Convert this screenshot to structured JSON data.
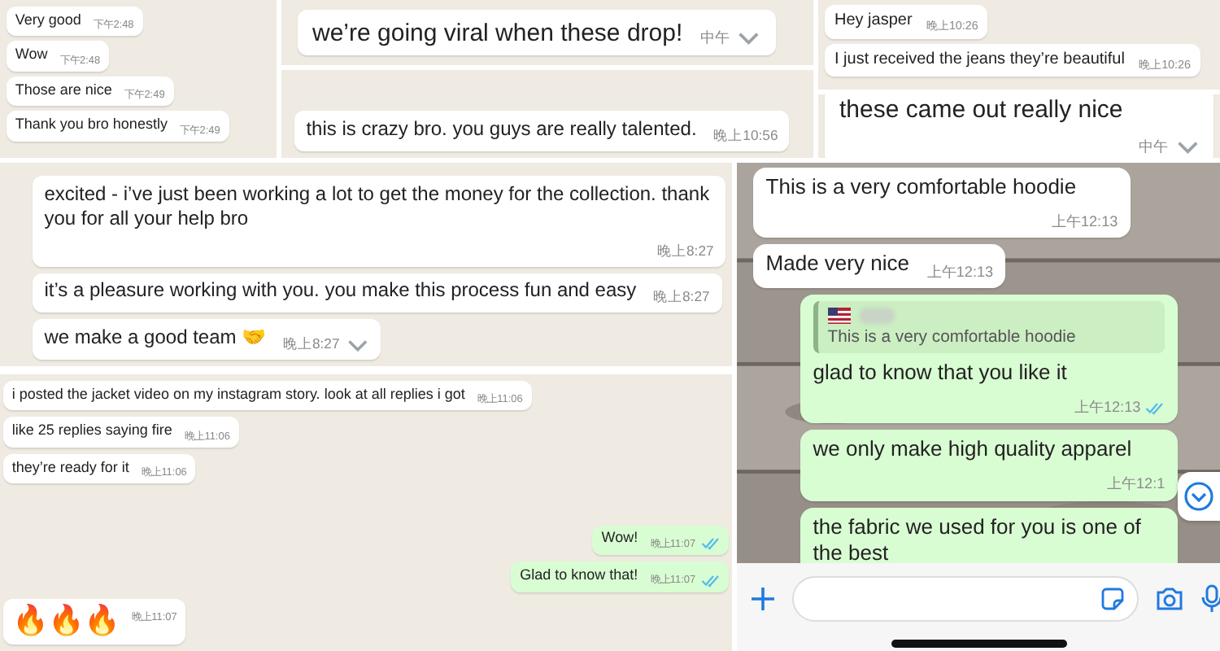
{
  "chats": [
    {
      "kind": "desktop",
      "messages": [
        {
          "text": "Very good",
          "time": "下午2:48",
          "outgoing": false
        },
        {
          "text": "Wow",
          "time": "下午2:48",
          "outgoing": false
        },
        {
          "text": "Those are nice",
          "time": "下午2:49",
          "outgoing": false
        },
        {
          "text": "Thank you bro honestly",
          "time": "下午2:49",
          "outgoing": false
        }
      ]
    },
    {
      "kind": "desktop",
      "messages": [
        {
          "text": "we’re going viral when these drop!",
          "time": "中午",
          "outgoing": false,
          "hovered": true
        }
      ]
    },
    {
      "kind": "desktop",
      "messages": [
        {
          "text": "this is crazy bro. you guys are really talented.",
          "time": "晚上10:56",
          "outgoing": false
        }
      ]
    },
    {
      "kind": "desktop",
      "messages": [
        {
          "text": "Hey jasper",
          "time": "晚上10:26",
          "outgoing": false
        },
        {
          "text": "I just received the jeans they’re beautiful",
          "time": "晚上10:26",
          "outgoing": false
        }
      ]
    },
    {
      "kind": "desktop",
      "messages": [
        {
          "text": "these came out really nice",
          "time": "中午",
          "outgoing": false,
          "hovered": true
        }
      ]
    },
    {
      "kind": "desktop",
      "messages": [
        {
          "text": "excited - i’ve just been working a lot to get the money for the collection. thank you for all your help bro",
          "time": "晚上8:27",
          "outgoing": false
        },
        {
          "text": "it’s a pleasure working with you. you make this process fun and easy",
          "time": "晚上8:27",
          "outgoing": false
        },
        {
          "text": "we make a good team 🤝",
          "time": "晚上8:27",
          "outgoing": false,
          "hovered": true
        }
      ]
    },
    {
      "kind": "desktop",
      "messages": [
        {
          "text": "i posted the jacket video on my instagram story. look at all replies i got",
          "time": "晚上11:06",
          "outgoing": false
        },
        {
          "text": "like 25 replies saying fire",
          "time": "晚上11:06",
          "outgoing": false
        },
        {
          "text": "they’re ready for it",
          "time": "晚上11:06",
          "outgoing": false
        },
        {
          "text": "Wow!",
          "time": "晚上11:07",
          "outgoing": true,
          "read": true
        },
        {
          "text": "Glad to know that!",
          "time": "晚上11:07",
          "outgoing": true,
          "read": true
        },
        {
          "text": "🔥🔥🔥",
          "time": "晚上11:07",
          "outgoing": false
        }
      ]
    },
    {
      "kind": "phone",
      "messages": [
        {
          "text": "This is a very comfortable hoodie",
          "time": "上午12:13",
          "outgoing": false
        },
        {
          "text": "Made very nice",
          "time": "上午12:13",
          "outgoing": false
        },
        {
          "text": "glad to know that you like it",
          "time": "上午12:13",
          "outgoing": true,
          "read": true,
          "quote": {
            "text": "This is a very comfortable hoodie"
          }
        },
        {
          "text": "we only make high quality apparel",
          "time": "上午12:1",
          "outgoing": true
        },
        {
          "text": "the fabric we used for you is one of the best",
          "outgoing": true
        }
      ]
    }
  ]
}
